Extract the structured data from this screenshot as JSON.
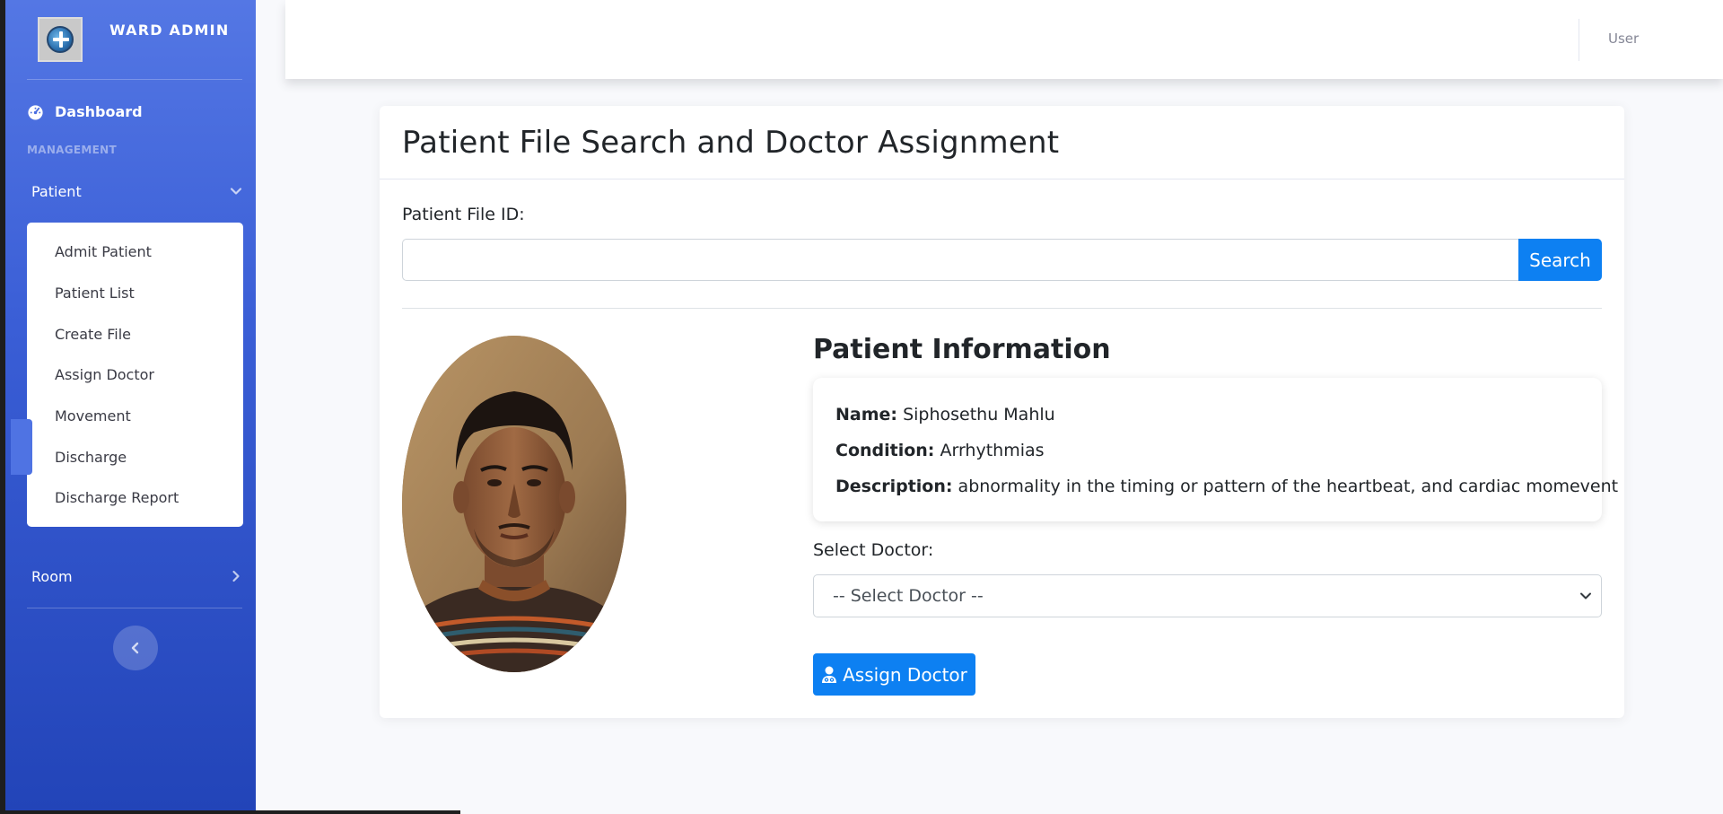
{
  "sidebar": {
    "brand_title": "WARD ADMIN",
    "dashboard_label": "Dashboard",
    "section_heading": "MANAGEMENT",
    "patient_label": "Patient",
    "patient_submenu": [
      {
        "label": "Admit Patient"
      },
      {
        "label": "Patient List"
      },
      {
        "label": "Create File"
      },
      {
        "label": "Assign Doctor"
      },
      {
        "label": "Movement"
      },
      {
        "label": "Discharge"
      },
      {
        "label": "Discharge Report"
      }
    ],
    "room_label": "Room"
  },
  "topbar": {
    "user_label": "User"
  },
  "page": {
    "title": "Patient File Search and Doctor Assignment",
    "file_id_label": "Patient File ID:",
    "search_value": "",
    "search_button": "Search",
    "info_title": "Patient Information",
    "name_label": "Name:",
    "name_value": "Siphosethu Mahlu",
    "condition_label": "Condition:",
    "condition_value": "Arrhythmias",
    "description_label": "Description:",
    "description_value": "abnormality in the timing or pattern of the heartbeat, and cardiac momevent",
    "select_doctor_label": "Select Doctor:",
    "select_doctor_value": "-- Select Doctor --",
    "assign_button": "Assign Doctor"
  },
  "colors": {
    "sidebar_top": "#5477e4",
    "sidebar_bottom": "#2244b8",
    "primary_button": "#0d80f2"
  }
}
